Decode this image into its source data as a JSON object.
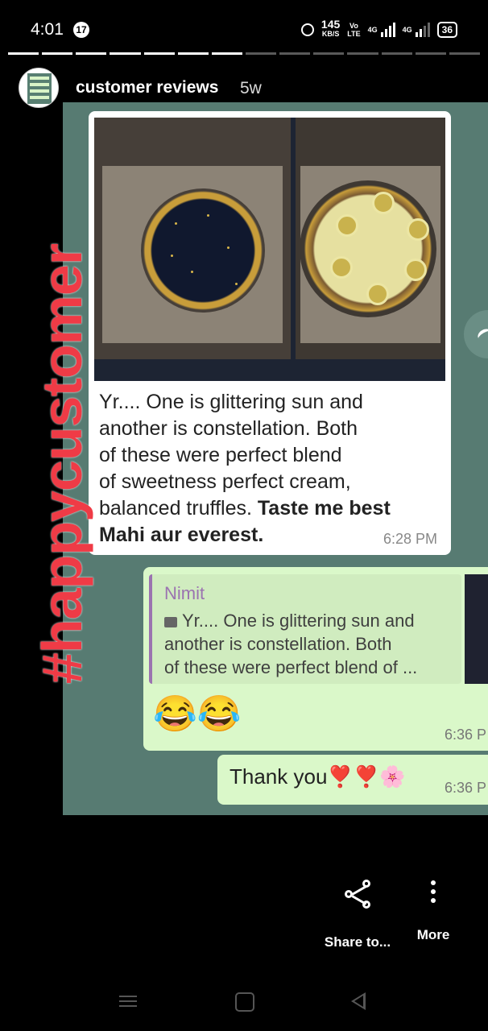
{
  "status_bar": {
    "time": "4:01",
    "notification_count": "17",
    "speed_value": "145",
    "speed_unit": "KB/S",
    "volte_top": "Vo",
    "volte_bottom": "LTE",
    "network": "4G",
    "battery": "36"
  },
  "story": {
    "segments_total": 14,
    "segments_done": 7,
    "account_name": "customer reviews",
    "posted_ago": "5w",
    "hashtag": "#happycustomer"
  },
  "chat": {
    "message_line1": "Yr.... One is glittering sun and",
    "message_line2": "another is constellation. Both",
    "message_line3": "of these were perfect blend",
    "message_line4": "of sweetness perfect cream,",
    "message_line5_normal": "balanced truffles. ",
    "message_line5_bold": "Taste me best",
    "message_line6_bold": "Mahi aur everest.",
    "message_time": "6:28 PM",
    "reply_quote_name": "Nimit",
    "reply_quote_line1": "Yr.... One is glittering sun and",
    "reply_quote_line2": "another is constellation. Both",
    "reply_quote_line3": "of these were perfect blend of ...",
    "reply_emojis": "😂😂",
    "reply_time": "6:36 P",
    "thanks_text": "Thank you❣️❣️🌸",
    "thanks_time": "6:36 P"
  },
  "actions": {
    "share_label": "Share to...",
    "more_label": "More"
  },
  "icons": {
    "share": "share-icon",
    "more": "more-vertical-icon",
    "nav_menu": "menu-icon",
    "nav_home": "home-icon",
    "nav_back": "back-icon"
  }
}
